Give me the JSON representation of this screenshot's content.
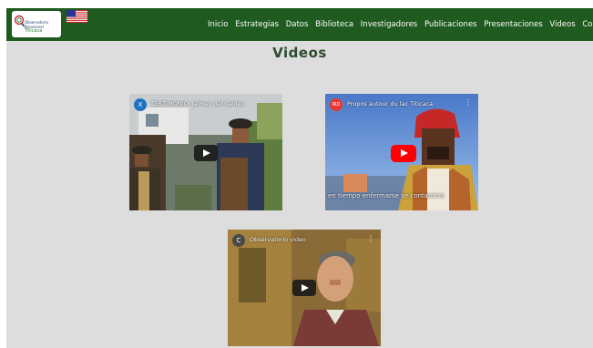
{
  "nav": {
    "logo_text": [
      "Observatorio",
      "Binacional",
      "Titicaca"
    ],
    "links": [
      "Inicio",
      "Estrategias",
      "Datos",
      "Biblioteca",
      "Investigadores",
      "Publicaciones",
      "Presentaciones",
      "Videos",
      "Contacto"
    ]
  },
  "page_title": "Videos",
  "videos": [
    {
      "title": "TESTIMONIO: Jaímes del Caldes",
      "avatar": "X",
      "avatar_color": "#1e73be"
    },
    {
      "title": "Propos autour du lac Titicaca",
      "avatar": "IRD",
      "avatar_color": "#e53935",
      "caption": "en tiempo enfermarse se contaminó"
    },
    {
      "title": "Observatorio video",
      "avatar": "C",
      "avatar_color": "#4a4a4a"
    }
  ],
  "colors": {
    "navbar": "#1f5a1f",
    "page_bg": "#dddddd",
    "youtube_red": "#ff0000"
  }
}
